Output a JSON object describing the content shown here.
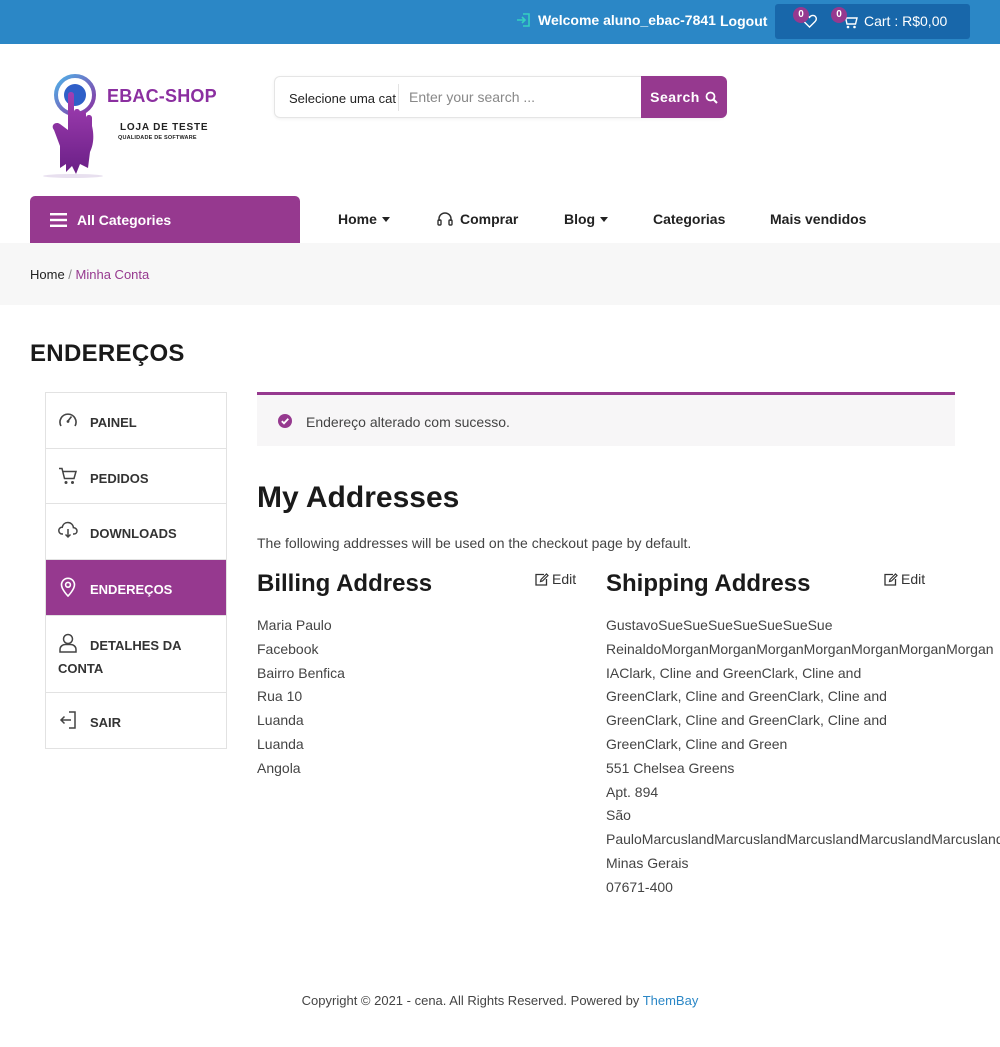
{
  "topbar": {
    "welcome": "Welcome aluno_ebac-7841 !",
    "logout": "Logout",
    "wishlist_count": "0",
    "cart_count": "0",
    "cart_label": "Cart : R$0,00"
  },
  "logo": {
    "title": "EBAC-SHOP",
    "subtitle": "LOJA DE TESTE",
    "tagline": "QUALIDADE DE SOFTWARE"
  },
  "search": {
    "category": "Selecione uma cat",
    "placeholder": "Enter your search ...",
    "button": "Search"
  },
  "nav": {
    "all_categories": "All Categories",
    "items": [
      "Home",
      "Comprar",
      "Blog",
      "Categorias",
      "Mais vendidos"
    ]
  },
  "breadcrumb": {
    "home": "Home",
    "separator": " / ",
    "current": "Minha Conta"
  },
  "page_title": "ENDEREÇOS",
  "sidebar": {
    "items": [
      {
        "label": "PAINEL",
        "icon": "dashboard-icon"
      },
      {
        "label": "PEDIDOS",
        "icon": "cart-icon"
      },
      {
        "label": "DOWNLOADS",
        "icon": "cloud-download-icon"
      },
      {
        "label": "ENDEREÇOS",
        "icon": "map-pin-icon",
        "active": true
      },
      {
        "label": "DETALHES DA CONTA",
        "icon": "user-icon"
      },
      {
        "label": "SAIR",
        "icon": "logout-icon"
      }
    ]
  },
  "notice": "Endereço alterado com sucesso.",
  "main": {
    "heading": "My Addresses",
    "intro": "The following addresses will be used on the checkout page by default.",
    "billing": {
      "title": "Billing Address",
      "edit": "Edit",
      "lines": [
        "Maria Paulo",
        "Facebook",
        "Bairro Benfica",
        "Rua 10",
        "Luanda",
        "Luanda",
        "Angola"
      ]
    },
    "shipping": {
      "title": "Shipping Address",
      "edit": "Edit",
      "lines": [
        "GustavoSueSueSueSueSueSueSue",
        "ReinaldoMorganMorganMorganMorganMorganMorganMorgan",
        "IAClark, Cline and GreenClark, Cline and",
        "GreenClark, Cline and GreenClark, Cline and",
        "GreenClark, Cline and GreenClark, Cline and",
        "GreenClark, Cline and Green",
        "551 Chelsea Greens",
        "Apt. 894",
        "São",
        "PauloMarcuslandMarcuslandMarcuslandMarcuslandMarcusland",
        "Minas Gerais",
        "07671-400"
      ]
    }
  },
  "footer": {
    "text": "Copyright © 2021 - cena. All Rights Reserved. Powered by ",
    "link": "ThemBay"
  },
  "colors": {
    "brand_purple": "#96398f",
    "topbar_blue": "#2b87c6",
    "cart_blue": "#1867aa"
  }
}
